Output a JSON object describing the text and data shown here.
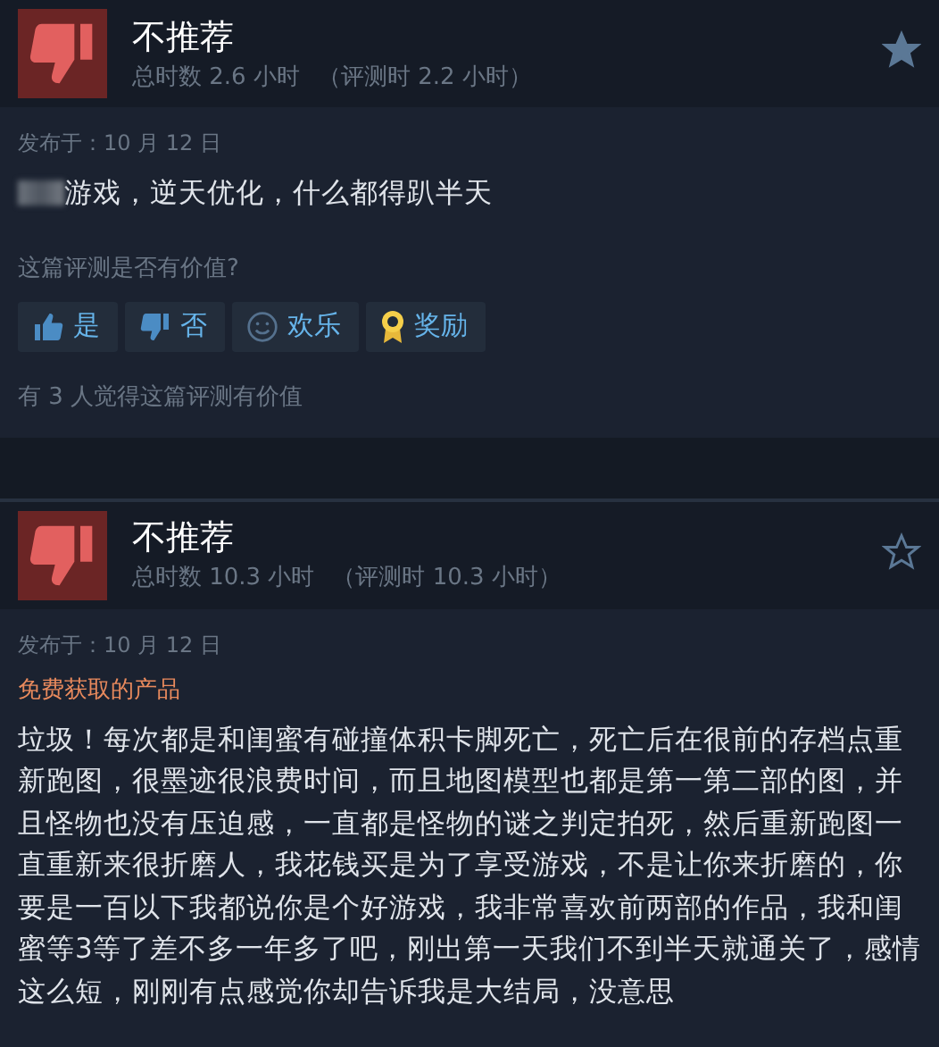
{
  "reviews": [
    {
      "verdict": "不推荐",
      "hours": "总时数 2.6 小时",
      "hours_at_review": "（评测时 2.2 小时）",
      "starred": true,
      "posted": "发布于：10 月 12 日",
      "censored_prefix": true,
      "body": "游戏，逆天优化，什么都得趴半天",
      "helpful_prompt": "这篇评测是否有价值?",
      "vote_buttons": [
        {
          "kind": "up",
          "label": "是"
        },
        {
          "kind": "down",
          "label": "否"
        },
        {
          "kind": "funny",
          "label": "欢乐"
        },
        {
          "kind": "award",
          "label": "奖励"
        }
      ],
      "helpful_count": "有 3 人觉得这篇评测有价值"
    },
    {
      "verdict": "不推荐",
      "hours": "总时数 10.3 小时",
      "hours_at_review": "（评测时 10.3 小时）",
      "starred": false,
      "posted": "发布于：10 月 12 日",
      "free_product": "免费获取的产品",
      "body": "垃圾！每次都是和闺蜜有碰撞体积卡脚死亡，死亡后在很前的存档点重新跑图，很墨迹很浪费时间，而且地图模型也都是第一第二部的图，并且怪物也没有压迫感，一直都是怪物的谜之判定拍死，然后重新跑图一直重新来很折磨人，我花钱买是为了享受游戏，不是让你来折磨的，你要是一百以下我都说你是个好游戏，我非常喜欢前两部的作品，我和闺蜜等3等了差不多一年多了吧，刚出第一天我们不到半天就通关了，感情这么短，刚刚有点感觉你却告诉我是大结局，没意思"
    }
  ]
}
